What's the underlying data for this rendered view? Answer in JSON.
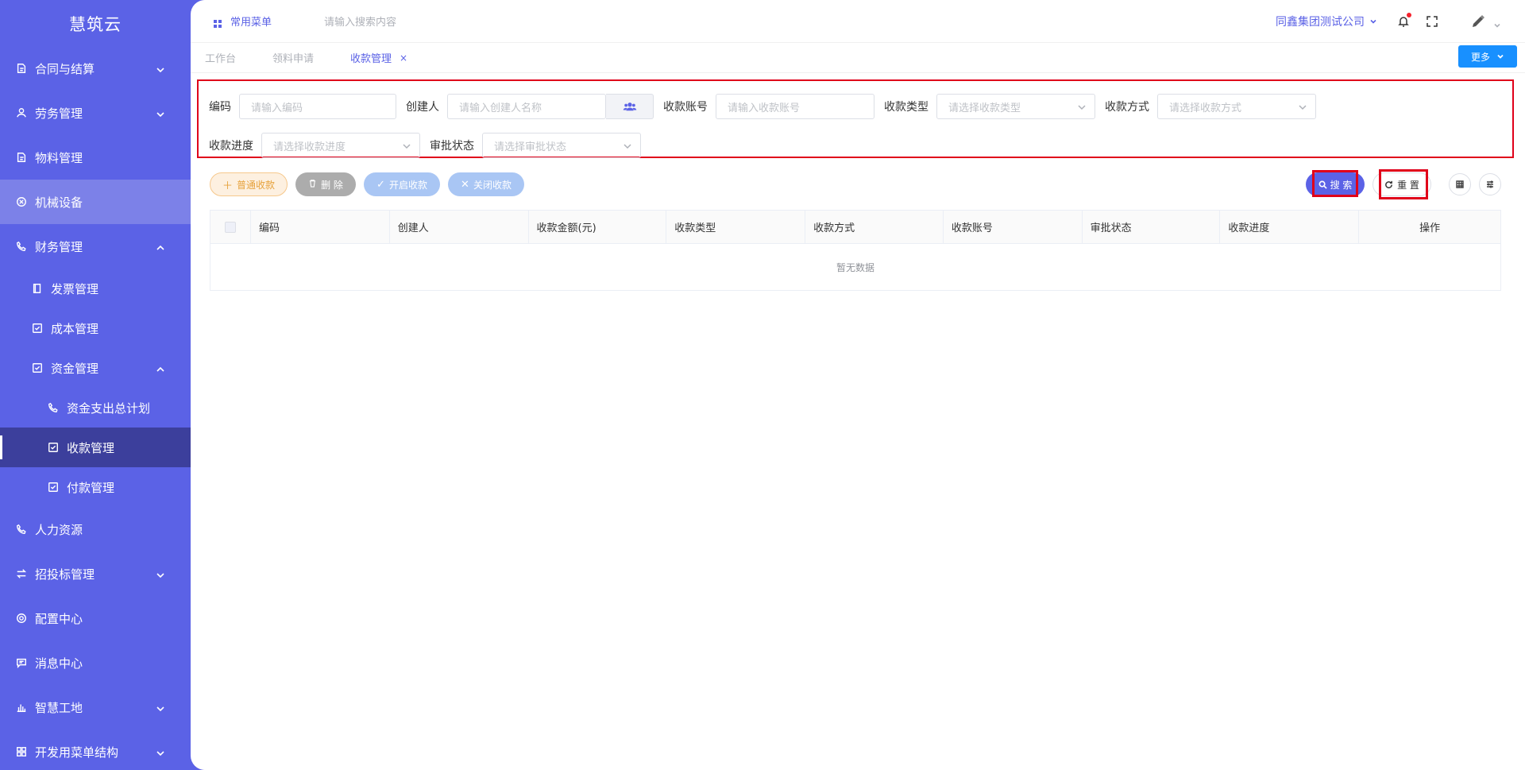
{
  "sidebar": {
    "logo": "慧筑云",
    "items": [
      {
        "label": "合同与结算",
        "icon": "edit-doc-icon",
        "chevron": "down"
      },
      {
        "label": "劳务管理",
        "icon": "user-icon",
        "chevron": "down"
      },
      {
        "label": "物料管理",
        "icon": "edit-doc-icon"
      },
      {
        "label": "机械设备",
        "icon": "circle-x-icon"
      },
      {
        "label": "财务管理",
        "icon": "phone-icon",
        "chevron": "up"
      },
      {
        "label": "发票管理",
        "icon": "book-icon"
      },
      {
        "label": "成本管理",
        "icon": "checkbox-icon"
      },
      {
        "label": "资金管理",
        "icon": "checkbox-icon",
        "chevron": "up"
      },
      {
        "label": "资金支出总计划",
        "icon": "phone-icon"
      },
      {
        "label": "收款管理",
        "icon": "checkbox-icon"
      },
      {
        "label": "付款管理",
        "icon": "checkbox-icon"
      },
      {
        "label": "人力资源",
        "icon": "phone-icon"
      },
      {
        "label": "招投标管理",
        "icon": "swap-icon",
        "chevron": "down"
      },
      {
        "label": "配置中心",
        "icon": "gear-icon"
      },
      {
        "label": "消息中心",
        "icon": "message-icon"
      },
      {
        "label": "智慧工地",
        "icon": "bar-chart-icon",
        "chevron": "down"
      },
      {
        "label": "开发用菜单结构",
        "icon": "grid-icon",
        "chevron": "down"
      }
    ]
  },
  "topbar": {
    "common_menu": "常用菜单",
    "search_placeholder": "请输入搜索内容",
    "company": "同鑫集团测试公司"
  },
  "tabs": {
    "items": [
      {
        "label": "工作台"
      },
      {
        "label": "领料申请"
      },
      {
        "label": "收款管理",
        "close": "×"
      }
    ],
    "more": "更多"
  },
  "filters": {
    "code": {
      "label": "编码",
      "placeholder": "请输入编码"
    },
    "creator": {
      "label": "创建人",
      "placeholder": "请输入创建人名称"
    },
    "account": {
      "label": "收款账号",
      "placeholder": "请输入收款账号"
    },
    "type": {
      "label": "收款类型",
      "placeholder": "请选择收款类型"
    },
    "method": {
      "label": "收款方式",
      "placeholder": "请选择收款方式"
    },
    "progress": {
      "label": "收款进度",
      "placeholder": "请选择收款进度"
    },
    "approval": {
      "label": "审批状态",
      "placeholder": "请选择审批状态"
    }
  },
  "actions": {
    "normal": "普通收款",
    "delete": "删 除",
    "open": "开启收款",
    "close": "关闭收款",
    "search": "搜 索",
    "reset": "重 置"
  },
  "table": {
    "columns": [
      "编码",
      "创建人",
      "收款金额(元)",
      "收款类型",
      "收款方式",
      "收款账号",
      "审批状态",
      "收款进度",
      "操作"
    ],
    "empty": "暂无数据"
  }
}
